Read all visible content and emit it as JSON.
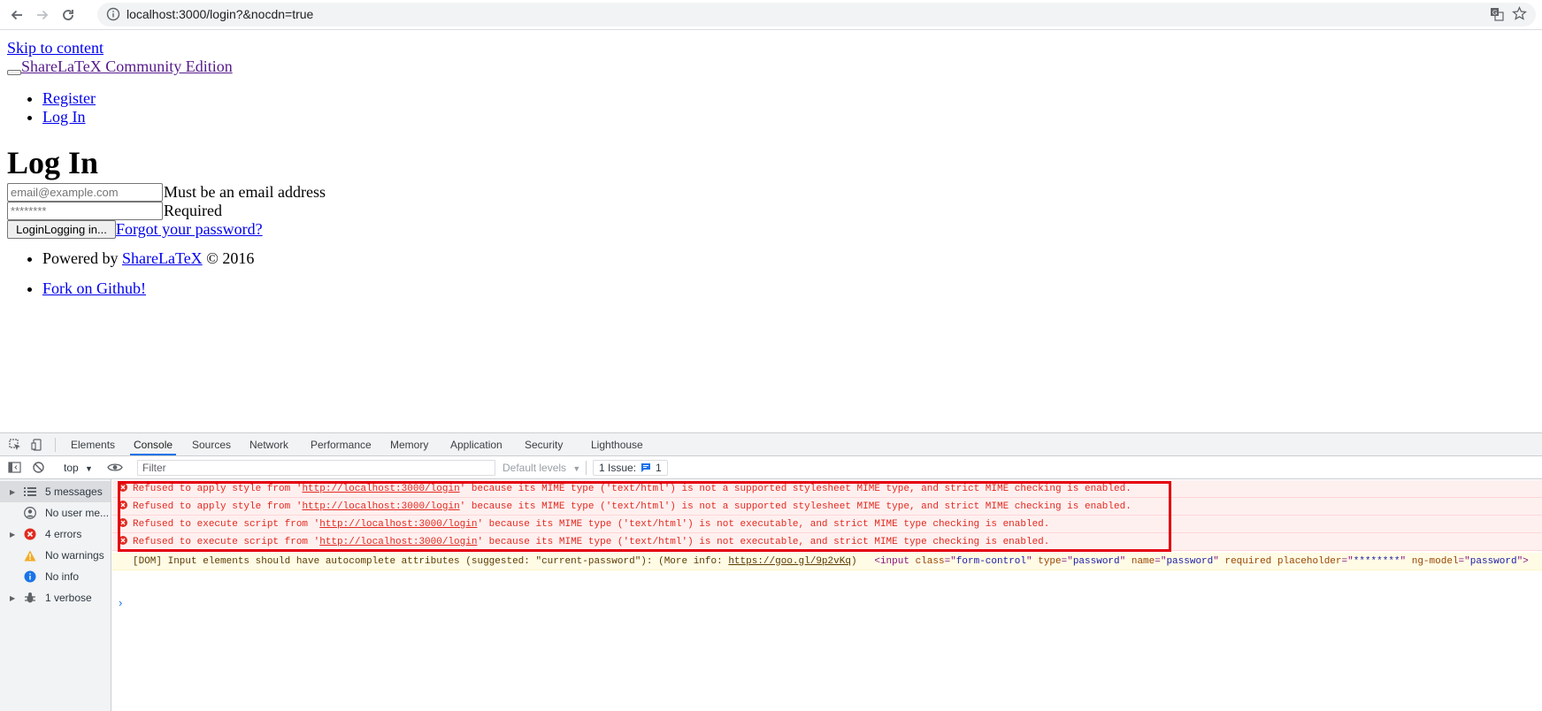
{
  "browser": {
    "url": "localhost:3000/login?&nocdn=true",
    "icons": [
      "back-arrow-icon",
      "forward-arrow-icon",
      "reload-icon",
      "info-icon",
      "translate-icon",
      "star-icon"
    ]
  },
  "page": {
    "skip_link": "Skip to content",
    "brand": "ShareLaTeX Community Edition",
    "nav": [
      "Register",
      "Log In"
    ],
    "heading": "Log In",
    "email": {
      "placeholder": "email@example.com",
      "hint": "Must be an email address"
    },
    "password": {
      "placeholder": "********",
      "hint": "Required"
    },
    "login_button": "LoginLogging in...",
    "forgot_link": "Forgot your password?",
    "footer": {
      "powered_prefix": "Powered by ",
      "powered_link": "ShareLaTeX",
      "powered_suffix": " © 2016",
      "fork_link": "Fork on Github!"
    }
  },
  "devtools": {
    "tabs": [
      "Elements",
      "Console",
      "Sources",
      "Network",
      "Performance",
      "Memory",
      "Application",
      "Security",
      "Lighthouse"
    ],
    "active_tab": "Console",
    "toolbar": {
      "context": "top",
      "filter_placeholder": "Filter",
      "levels": "Default levels",
      "issues_label": "1 Issue:",
      "issues_count": "1"
    },
    "sidebar": [
      {
        "label": "5 messages",
        "icon": "list-icon",
        "expandable": true
      },
      {
        "label": "No user me...",
        "icon": "user-icon",
        "expandable": false
      },
      {
        "label": "4 errors",
        "icon": "error-icon",
        "expandable": true
      },
      {
        "label": "No warnings",
        "icon": "warning-icon",
        "expandable": false
      },
      {
        "label": "No info",
        "icon": "info-icon",
        "expandable": false
      },
      {
        "label": "1 verbose",
        "icon": "bug-icon",
        "expandable": true
      }
    ],
    "errors": [
      {
        "pre": "Refused to apply style from '",
        "link": "http://localhost:3000/login",
        "post": "' because its MIME type ('text/html') is not a supported stylesheet MIME type, and strict MIME checking is enabled."
      },
      {
        "pre": "Refused to apply style from '",
        "link": "http://localhost:3000/login",
        "post": "' because its MIME type ('text/html') is not a supported stylesheet MIME type, and strict MIME checking is enabled."
      },
      {
        "pre": "Refused to execute script from '",
        "link": "http://localhost:3000/login",
        "post": "' because its MIME type ('text/html') is not executable, and strict MIME type checking is enabled."
      },
      {
        "pre": "Refused to execute script from '",
        "link": "http://localhost:3000/login",
        "post": "' because its MIME type ('text/html') is not executable, and strict MIME type checking is enabled."
      }
    ],
    "warning": {
      "pre": "[DOM] Input elements should have autocomplete attributes (suggested: \"current-password\"): (More info: ",
      "link": "https://goo.gl/9p2vKq",
      "post": ")",
      "html": {
        "open": "<input ",
        "attrs": [
          {
            "name": "class",
            "value": "form-control"
          },
          {
            "name": "type",
            "value": "password"
          },
          {
            "name": "name",
            "value": "password"
          },
          {
            "name": "required",
            "value": ""
          },
          {
            "name": "placeholder",
            "value": "********"
          },
          {
            "name": "ng-model",
            "value": "password"
          }
        ],
        "close": ">"
      }
    },
    "prompt": "›",
    "colors": {
      "error_bg": "#fff0f0",
      "error_text": "#e22a1f",
      "warn_bg": "#fffbe5",
      "highlight": "#e4000f",
      "accent": "#1a73e8"
    }
  }
}
